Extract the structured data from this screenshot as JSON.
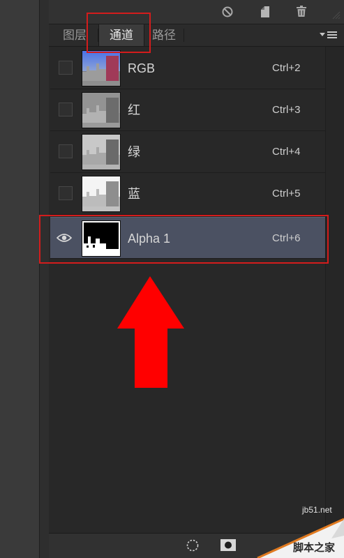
{
  "panel": {
    "toolbar_icons": [
      "no-entry-icon",
      "new-document-icon",
      "trash-icon",
      "resize-grip-icon"
    ],
    "tabs": [
      {
        "label": "图层",
        "active": false
      },
      {
        "label": "通道",
        "active": true
      },
      {
        "label": "路径",
        "active": false
      }
    ],
    "menu_icon": "panel-menu-icon",
    "channels": [
      {
        "name": "RGB",
        "shortcut": "Ctrl+2",
        "visible": false,
        "selected": false
      },
      {
        "name": "红",
        "shortcut": "Ctrl+3",
        "visible": false,
        "selected": false
      },
      {
        "name": "绿",
        "shortcut": "Ctrl+4",
        "visible": false,
        "selected": false
      },
      {
        "name": "蓝",
        "shortcut": "Ctrl+5",
        "visible": false,
        "selected": false
      },
      {
        "name": "Alpha 1",
        "shortcut": "Ctrl+6",
        "visible": true,
        "selected": true
      }
    ],
    "bottom_icons": [
      "load-selection-icon",
      "save-selection-as-channel-icon"
    ]
  },
  "annotations": {
    "highlight_color": "#d41c1c",
    "arrow_direction": "up",
    "arrow_color": "#ff0000"
  },
  "watermark": {
    "url": "jb51.net",
    "site_name": "脚本之家"
  },
  "colors": {
    "panel_bg": "#282828",
    "selected_row": "#4b5162",
    "text": "#d6d6d6"
  }
}
